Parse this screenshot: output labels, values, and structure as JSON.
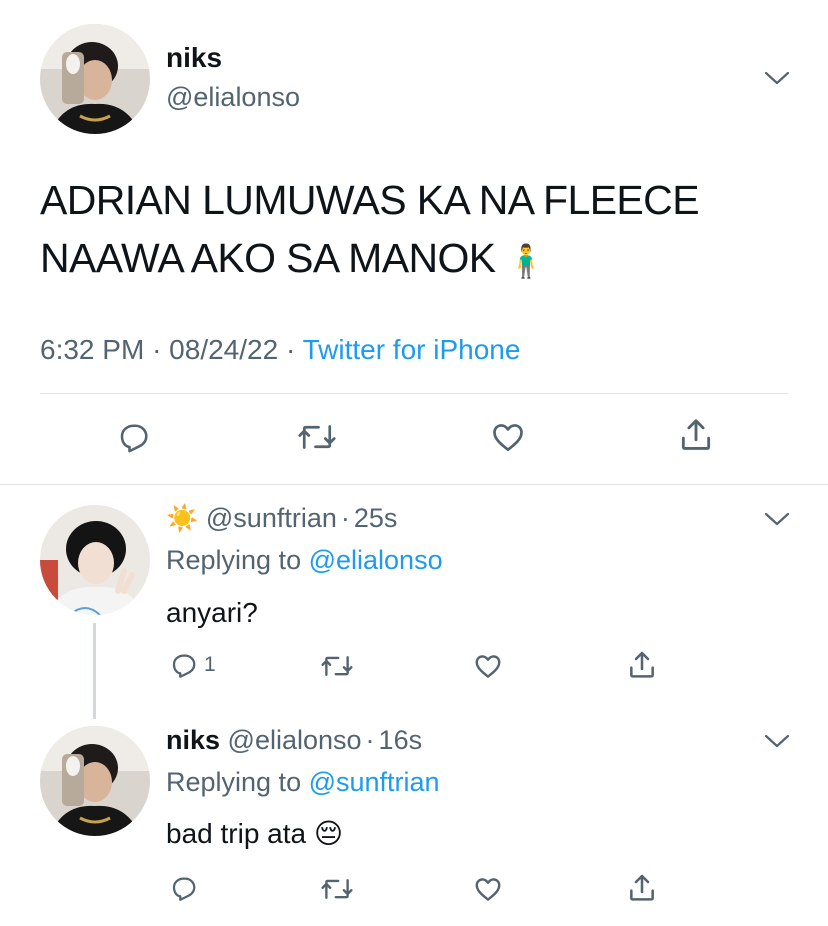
{
  "main_tweet": {
    "name": "niks",
    "handle": "@elialonso",
    "text_line1": "ADRIAN LUMUWAS KA NA FLEECE",
    "text_line2": "NAAWA AKO SA MANOK",
    "emoji": "🧍‍♂️",
    "time": "6:32 PM",
    "date": "08/24/22",
    "source": "Twitter for iPhone",
    "sep": "·"
  },
  "replies": [
    {
      "name_emoji": "☀️",
      "handle": "@sunftrian",
      "time": "25s",
      "replying_prefix": "Replying to",
      "replying_to": "@elialonso",
      "text": "anyari?",
      "reply_count": "1"
    },
    {
      "name": "niks",
      "handle": "@elialonso",
      "time": "16s",
      "replying_prefix": "Replying to",
      "replying_to": "@sunftrian",
      "text": "bad trip ata",
      "emoji": "😔"
    }
  ],
  "icons": {
    "reply": "reply-icon",
    "retweet": "retweet-icon",
    "like": "heart-icon",
    "share": "share-icon",
    "more": "chevron-down-icon"
  },
  "colors": {
    "link": "#1d9bf0",
    "muted": "#536471",
    "text": "#0f1419",
    "divider": "#dfe3e6"
  }
}
